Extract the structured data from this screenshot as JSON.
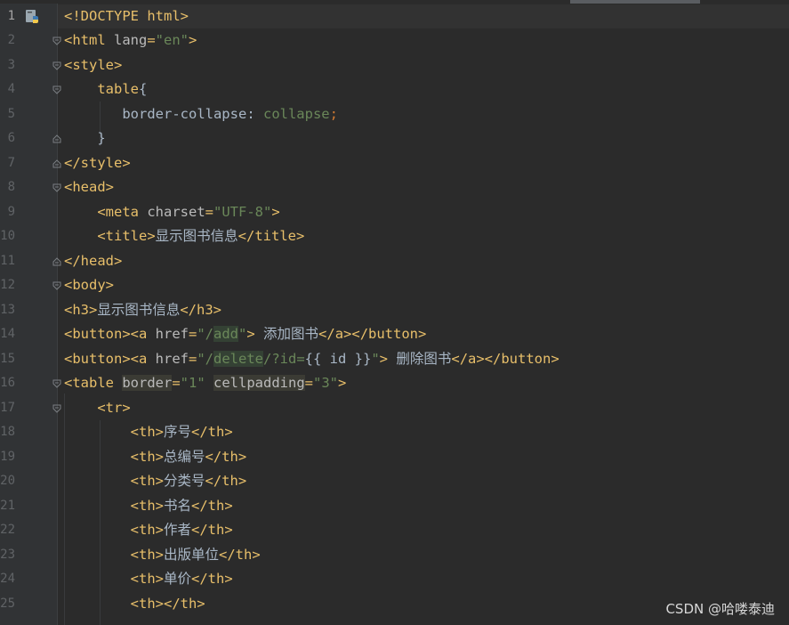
{
  "file": {
    "icon": "python-html-file-icon"
  },
  "lines": [
    {
      "n": "1",
      "parts": [
        [
          "t-tag",
          "<!DOCTYPE html>"
        ]
      ]
    },
    {
      "n": "2",
      "parts": [
        [
          "t-tag",
          "<html "
        ],
        [
          "t-attr",
          "lang"
        ],
        [
          "t-tag",
          "="
        ],
        [
          "t-val",
          "\"en\""
        ],
        [
          "t-tag",
          ">"
        ]
      ]
    },
    {
      "n": "3",
      "parts": [
        [
          "t-tag",
          "<style>"
        ]
      ]
    },
    {
      "n": "4",
      "parts": [
        [
          "t-text",
          "    "
        ],
        [
          "t-sel",
          "table"
        ],
        [
          "t-text",
          "{"
        ]
      ]
    },
    {
      "n": "5",
      "parts": [
        [
          "t-text",
          "       "
        ],
        [
          "t-css-prop",
          "border-collapse"
        ],
        [
          "t-text",
          ": "
        ],
        [
          "t-css-val",
          "collapse"
        ],
        [
          "t-punct",
          ";"
        ]
      ]
    },
    {
      "n": "6",
      "parts": [
        [
          "t-text",
          "    }"
        ]
      ]
    },
    {
      "n": "7",
      "parts": [
        [
          "t-tag",
          "</style>"
        ]
      ]
    },
    {
      "n": "8",
      "parts": [
        [
          "t-tag",
          "<head>"
        ]
      ]
    },
    {
      "n": "9",
      "parts": [
        [
          "t-text",
          "    "
        ],
        [
          "t-tag",
          "<meta "
        ],
        [
          "t-attr",
          "charset"
        ],
        [
          "t-tag",
          "="
        ],
        [
          "t-val",
          "\"UTF-8\""
        ],
        [
          "t-tag",
          ">"
        ]
      ]
    },
    {
      "n": "10",
      "parts": [
        [
          "t-text",
          "    "
        ],
        [
          "t-tag",
          "<title>"
        ],
        [
          "t-text",
          "显示图书信息"
        ],
        [
          "t-tag",
          "</title>"
        ]
      ]
    },
    {
      "n": "11",
      "parts": [
        [
          "t-tag",
          "</head>"
        ]
      ]
    },
    {
      "n": "12",
      "parts": [
        [
          "t-tag",
          "<body>"
        ]
      ]
    },
    {
      "n": "13",
      "parts": [
        [
          "t-tag",
          "<h3>"
        ],
        [
          "t-text",
          "显示图书信息"
        ],
        [
          "t-tag",
          "</h3>"
        ]
      ]
    },
    {
      "n": "14",
      "parts": [
        [
          "t-tag",
          "<button><a "
        ],
        [
          "t-attr",
          "href"
        ],
        [
          "t-tag",
          "="
        ],
        [
          "t-val",
          "\"/"
        ],
        [
          "t-val hl-word",
          "add"
        ],
        [
          "t-val",
          "\""
        ],
        [
          "t-tag",
          ">"
        ],
        [
          "t-text",
          " 添加图书"
        ],
        [
          "t-tag",
          "</a></button>"
        ]
      ]
    },
    {
      "n": "15",
      "parts": [
        [
          "t-tag",
          "<button><a "
        ],
        [
          "t-attr",
          "href"
        ],
        [
          "t-tag",
          "="
        ],
        [
          "t-val",
          "\"/"
        ],
        [
          "t-val hl-word",
          "delete"
        ],
        [
          "t-val",
          "/?id="
        ],
        [
          "t-text",
          "{{ id }}"
        ],
        [
          "t-val",
          "\""
        ],
        [
          "t-tag",
          ">"
        ],
        [
          "t-text",
          " 删除图书"
        ],
        [
          "t-tag",
          "</a></button>"
        ]
      ]
    },
    {
      "n": "16",
      "parts": [
        [
          "t-tag",
          "<table "
        ],
        [
          "t-attr hl-box",
          "border"
        ],
        [
          "t-tag",
          "="
        ],
        [
          "t-val",
          "\"1\""
        ],
        [
          "t-text",
          " "
        ],
        [
          "t-attr hl-box",
          "cellpadding"
        ],
        [
          "t-tag",
          "="
        ],
        [
          "t-val",
          "\"3\""
        ],
        [
          "t-tag",
          ">"
        ]
      ]
    },
    {
      "n": "17",
      "parts": [
        [
          "t-text",
          "    "
        ],
        [
          "t-tag",
          "<tr>"
        ]
      ]
    },
    {
      "n": "18",
      "parts": [
        [
          "t-text",
          "        "
        ],
        [
          "t-tag",
          "<th>"
        ],
        [
          "t-text",
          "序号"
        ],
        [
          "t-tag",
          "</th>"
        ]
      ]
    },
    {
      "n": "19",
      "parts": [
        [
          "t-text",
          "        "
        ],
        [
          "t-tag",
          "<th>"
        ],
        [
          "t-text",
          "总编号"
        ],
        [
          "t-tag",
          "</th>"
        ]
      ]
    },
    {
      "n": "20",
      "parts": [
        [
          "t-text",
          "        "
        ],
        [
          "t-tag",
          "<th>"
        ],
        [
          "t-text",
          "分类号"
        ],
        [
          "t-tag",
          "</th>"
        ]
      ]
    },
    {
      "n": "21",
      "parts": [
        [
          "t-text",
          "        "
        ],
        [
          "t-tag",
          "<th>"
        ],
        [
          "t-text",
          "书名"
        ],
        [
          "t-tag",
          "</th>"
        ]
      ]
    },
    {
      "n": "22",
      "parts": [
        [
          "t-text",
          "        "
        ],
        [
          "t-tag",
          "<th>"
        ],
        [
          "t-text",
          "作者"
        ],
        [
          "t-tag",
          "</th>"
        ]
      ]
    },
    {
      "n": "23",
      "parts": [
        [
          "t-text",
          "        "
        ],
        [
          "t-tag",
          "<th>"
        ],
        [
          "t-text",
          "出版单位"
        ],
        [
          "t-tag",
          "</th>"
        ]
      ]
    },
    {
      "n": "24",
      "parts": [
        [
          "t-text",
          "        "
        ],
        [
          "t-tag",
          "<th>"
        ],
        [
          "t-text",
          "单价"
        ],
        [
          "t-tag",
          "</th>"
        ]
      ]
    },
    {
      "n": "25",
      "parts": [
        [
          "t-text",
          "        "
        ],
        [
          "t-tag",
          "<th></th>"
        ]
      ]
    }
  ],
  "watermark": "CSDN @哈喽泰迪"
}
